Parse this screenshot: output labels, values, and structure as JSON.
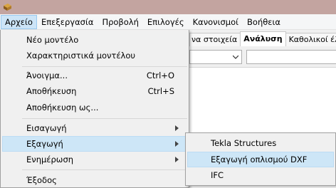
{
  "menubar": {
    "items": [
      {
        "label": "Αρχείο",
        "active": true
      },
      {
        "label": "Επεξεργασία"
      },
      {
        "label": "Προβολή"
      },
      {
        "label": "Επιλογές"
      },
      {
        "label": "Κανονισμοί"
      },
      {
        "label": "Βοήθεια"
      }
    ]
  },
  "background": {
    "tabs": [
      "να στοιχεία",
      "Ανάλυση",
      "Καθολικοί έλεγ"
    ]
  },
  "file_menu": {
    "items": [
      {
        "label": "Νέο μοντέλο"
      },
      {
        "label": "Χαρακτηριστικά μοντέλου"
      },
      {
        "label": "Άνοιγμα...",
        "shortcut": "Ctrl+O"
      },
      {
        "label": "Αποθήκευση",
        "shortcut": "Ctrl+S"
      },
      {
        "label": "Αποθήκευση ως..."
      },
      {
        "label": "Εισαγωγή",
        "has_submenu": true
      },
      {
        "label": "Εξαγωγή",
        "has_submenu": true,
        "highlighted": true
      },
      {
        "label": "Ενημέρωση",
        "has_submenu": true
      },
      {
        "label": "Έξοδος"
      }
    ]
  },
  "export_submenu": {
    "items": [
      {
        "label": "Tekla Structures"
      },
      {
        "label": "Εξαγωγή οπλισμού DXF",
        "highlighted": true
      },
      {
        "label": "IFC"
      }
    ]
  },
  "colors": {
    "titlebar": "#c3a4a0",
    "highlight": "#cde6f7",
    "menu_bg": "#f0f0f0"
  }
}
